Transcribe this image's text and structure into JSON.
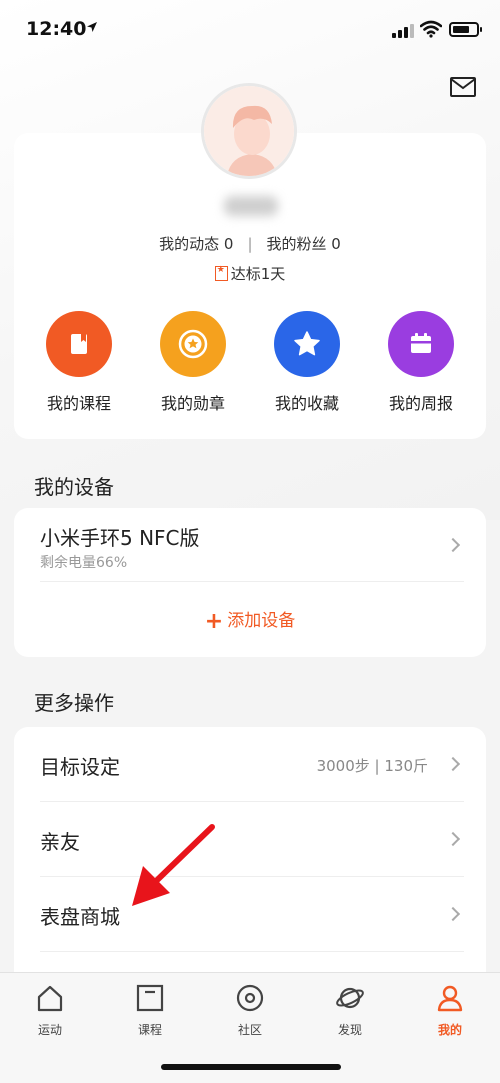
{
  "status_bar": {
    "time": "12:40"
  },
  "profile": {
    "stats_posts": "我的动态 0",
    "stats_fans": "我的粉丝 0",
    "stats_sep": "|",
    "days": "达标1天"
  },
  "quick_actions": [
    {
      "label": "我的课程",
      "color": "#f15a24",
      "icon": "course-icon"
    },
    {
      "label": "我的勋章",
      "color": "#f5a11e",
      "icon": "medal-icon"
    },
    {
      "label": "我的收藏",
      "color": "#2a66e8",
      "icon": "star-icon"
    },
    {
      "label": "我的周报",
      "color": "#9a3de0",
      "icon": "report-icon"
    }
  ],
  "devices": {
    "title": "我的设备",
    "item_name": "小米手环5 NFC版",
    "item_sub": "剩余电量66%",
    "add_plus": "+",
    "add_label": "添加设备"
  },
  "more": {
    "title": "更多操作",
    "rows": [
      {
        "label": "目标设定",
        "value": "3000步 | 130斤"
      },
      {
        "label": "亲友",
        "value": ""
      },
      {
        "label": "表盘商城",
        "value": ""
      }
    ]
  },
  "tabs": [
    {
      "label": "运动",
      "icon": "home-icon"
    },
    {
      "label": "课程",
      "icon": "course-tab-icon"
    },
    {
      "label": "社区",
      "icon": "community-icon"
    },
    {
      "label": "发现",
      "icon": "discover-icon"
    },
    {
      "label": "我的",
      "icon": "profile-icon",
      "active": true
    }
  ],
  "colors": {
    "accent": "#f15a24"
  }
}
